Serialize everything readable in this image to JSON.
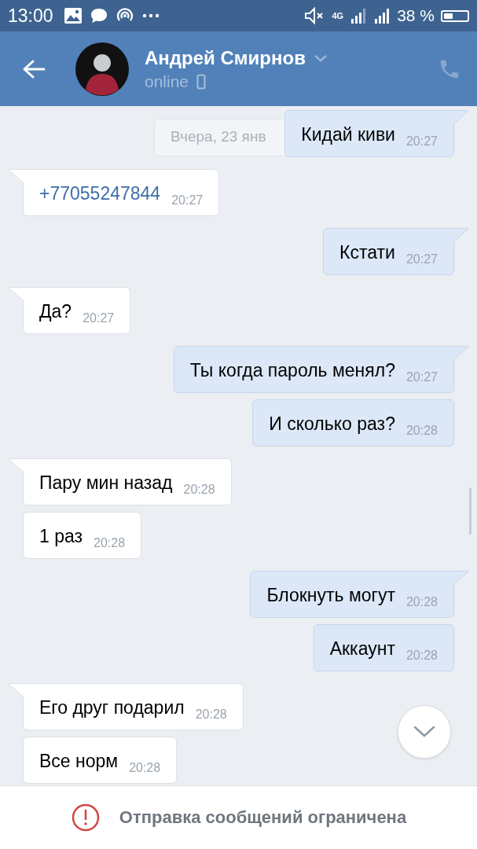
{
  "status_bar": {
    "time": "13:00",
    "network": "4G",
    "battery_percent": "38 %"
  },
  "header": {
    "name": "Андрей Смирнов",
    "status": "online"
  },
  "date_label": "Вчера, 23 янв",
  "messages": [
    {
      "outgoing": true,
      "kind": "text",
      "text": "Кидай киви",
      "time": "20:27"
    },
    {
      "outgoing": false,
      "kind": "link",
      "text": "+77055247844",
      "time": "20:27"
    },
    {
      "outgoing": true,
      "kind": "text",
      "text": "Кстати",
      "time": "20:27"
    },
    {
      "outgoing": false,
      "kind": "text",
      "text": "Да?",
      "time": "20:27"
    },
    {
      "outgoing": true,
      "kind": "text",
      "text": "Ты когда пароль менял?",
      "time": "20:27"
    },
    {
      "outgoing": true,
      "kind": "text",
      "text": "И сколько раз?",
      "time": "20:28"
    },
    {
      "outgoing": false,
      "kind": "text",
      "text": "Пару мин назад",
      "time": "20:28"
    },
    {
      "outgoing": false,
      "kind": "text",
      "text": "1 раз",
      "time": "20:28"
    },
    {
      "outgoing": true,
      "kind": "text",
      "text": "Блокнуть могут",
      "time": "20:28"
    },
    {
      "outgoing": true,
      "kind": "text",
      "text": "Аккаунт",
      "time": "20:28"
    },
    {
      "outgoing": false,
      "kind": "text",
      "text": "Его друг подарил",
      "time": "20:28"
    },
    {
      "outgoing": false,
      "kind": "text",
      "text": "Все норм",
      "time": "20:28"
    }
  ],
  "notice": "Отправка сообщений ограничена"
}
